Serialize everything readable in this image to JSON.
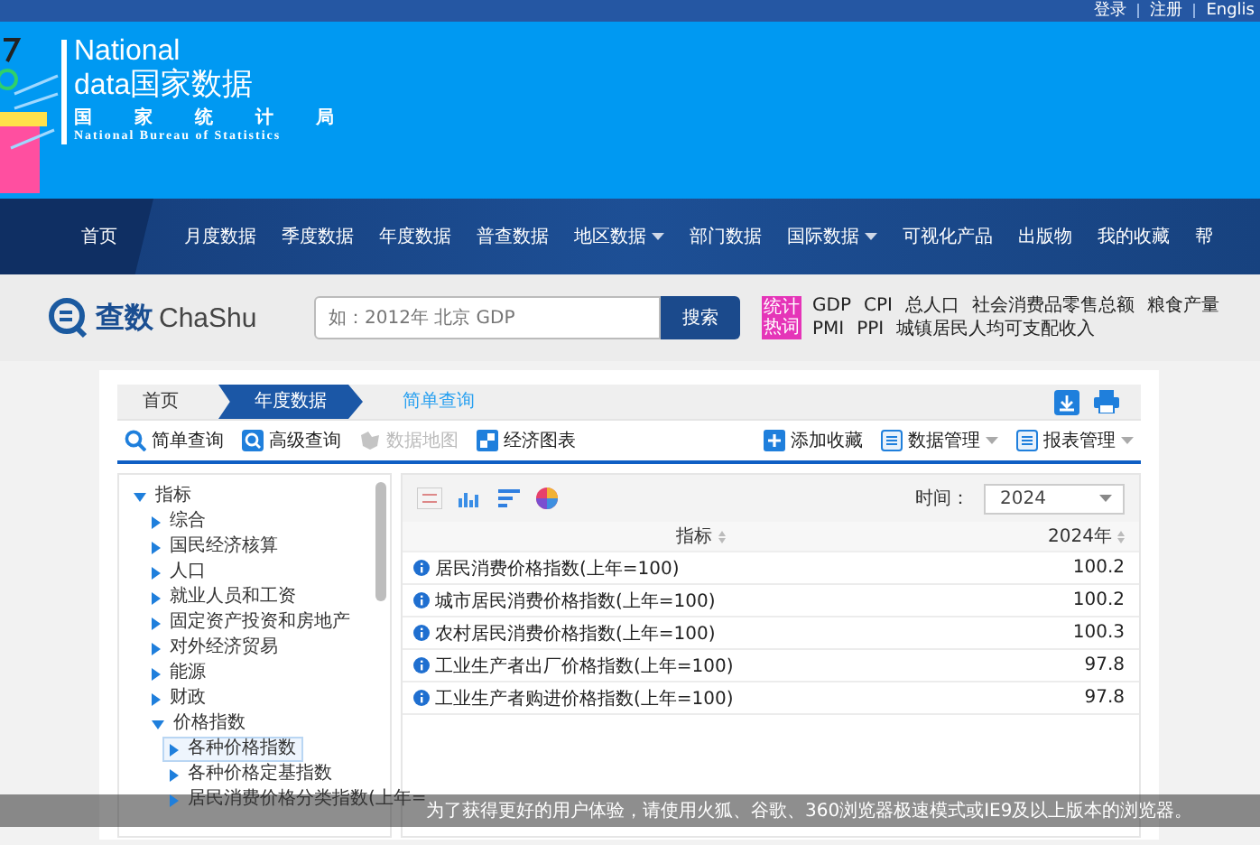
{
  "top_links": [
    "登录",
    "注册",
    "Englis"
  ],
  "logo": {
    "title_line1": "National",
    "title_line2_latin": "data",
    "title_line2_cn": "国家数据",
    "subtitle_cn": "国 家 统 计 局",
    "subtitle_en": "National Bureau of Statistics"
  },
  "nav": [
    {
      "label": "首页",
      "selected": true,
      "dropdown": false
    },
    {
      "label": "月度数据",
      "selected": false,
      "dropdown": false
    },
    {
      "label": "季度数据",
      "selected": false,
      "dropdown": false
    },
    {
      "label": "年度数据",
      "selected": false,
      "dropdown": false
    },
    {
      "label": "普查数据",
      "selected": false,
      "dropdown": false
    },
    {
      "label": "地区数据",
      "selected": false,
      "dropdown": true
    },
    {
      "label": "部门数据",
      "selected": false,
      "dropdown": false
    },
    {
      "label": "国际数据",
      "selected": false,
      "dropdown": true
    },
    {
      "label": "可视化产品",
      "selected": false,
      "dropdown": false
    },
    {
      "label": "出版物",
      "selected": false,
      "dropdown": false
    },
    {
      "label": "我的收藏",
      "selected": false,
      "dropdown": false
    },
    {
      "label": "帮",
      "selected": false,
      "dropdown": false
    }
  ],
  "chashu": {
    "brand_cn": "查数",
    "brand_en": "ChaShu",
    "search_placeholder": "如：2012年 北京 GDP",
    "search_button": "搜索",
    "hot_label": "统计热词",
    "hot_words": [
      [
        "GDP",
        "CPI",
        "总人口",
        "社会消费品零售总额",
        "粮食产量"
      ],
      [
        "PMI",
        "PPI",
        "城镇居民人均可支配收入"
      ]
    ]
  },
  "breadcrumb": [
    {
      "label": "首页",
      "selected": false
    },
    {
      "label": "年度数据",
      "selected": true
    },
    {
      "label": "简单查询",
      "selected": false
    }
  ],
  "tools": [
    {
      "label": "简单查询",
      "disabled": false
    },
    {
      "label": "高级查询",
      "disabled": false
    },
    {
      "label": "数据地图",
      "disabled": true
    },
    {
      "label": "经济图表",
      "disabled": false
    }
  ],
  "actions": [
    {
      "label": "添加收藏",
      "dropdown": false
    },
    {
      "label": "数据管理",
      "dropdown": true
    },
    {
      "label": "报表管理",
      "dropdown": true
    }
  ],
  "tree": [
    {
      "label": "指标",
      "expanded": true,
      "selected": false,
      "children": [
        {
          "label": "综合",
          "expanded": false,
          "selected": false
        },
        {
          "label": "国民经济核算",
          "expanded": false,
          "selected": false
        },
        {
          "label": "人口",
          "expanded": false,
          "selected": false
        },
        {
          "label": "就业人员和工资",
          "expanded": false,
          "selected": false
        },
        {
          "label": "固定资产投资和房地产",
          "expanded": false,
          "selected": false
        },
        {
          "label": "对外经济贸易",
          "expanded": false,
          "selected": false
        },
        {
          "label": "能源",
          "expanded": false,
          "selected": false
        },
        {
          "label": "财政",
          "expanded": false,
          "selected": false
        },
        {
          "label": "价格指数",
          "expanded": true,
          "selected": false,
          "children": [
            {
              "label": "各种价格指数",
              "expanded": false,
              "selected": true
            },
            {
              "label": "各种价格定基指数",
              "expanded": false,
              "selected": false
            },
            {
              "label": "居民消费价格分类指数(上年=",
              "expanded": false,
              "selected": false
            }
          ]
        }
      ]
    }
  ],
  "time_filter": {
    "label": "时间：",
    "value": "2024"
  },
  "table": {
    "columns": [
      "指标",
      "2024年"
    ],
    "rows": [
      {
        "label": "居民消费价格指数(上年=100)",
        "value": "100.2"
      },
      {
        "label": "城市居民消费价格指数(上年=100)",
        "value": "100.2"
      },
      {
        "label": "农村居民消费价格指数(上年=100)",
        "value": "100.3"
      },
      {
        "label": "工业生产者出厂价格指数(上年=100)",
        "value": "97.8"
      },
      {
        "label": "工业生产者购进价格指数(上年=100)",
        "value": "97.8"
      }
    ]
  },
  "notice": "为了获得更好的用户体验，请使用火狐、谷歌、360浏览器极速模式或IE9及以上版本的浏览器。"
}
